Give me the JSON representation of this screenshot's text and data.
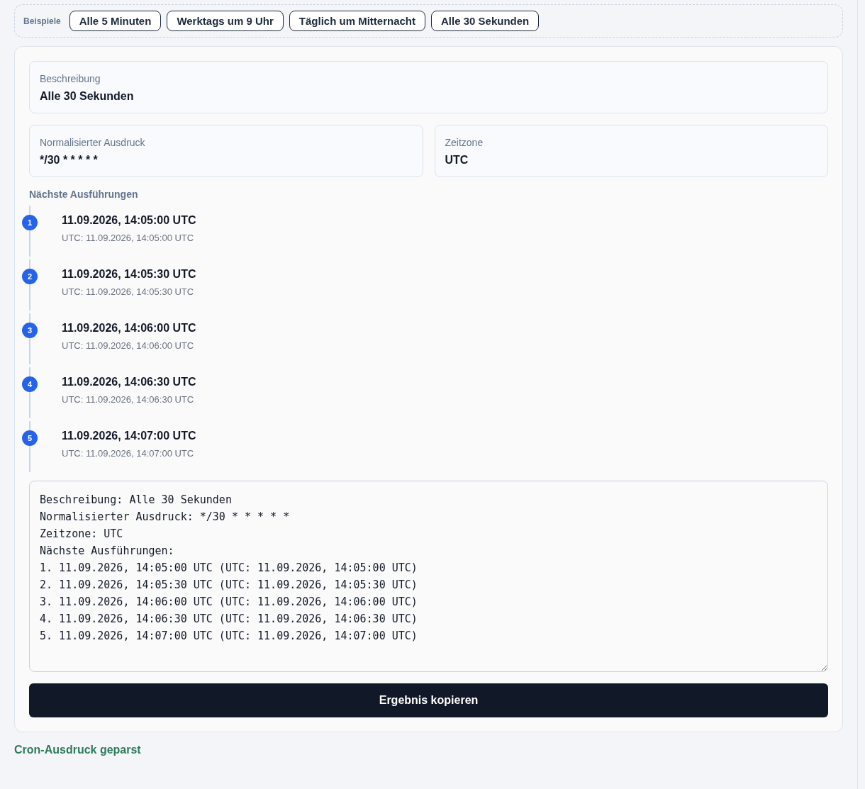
{
  "examples": {
    "label": "Beispiele",
    "buttons": [
      "Alle 5 Minuten",
      "Werktags um 9 Uhr",
      "Täglich um Mitternacht",
      "Alle 30 Sekunden"
    ]
  },
  "result": {
    "description": {
      "label": "Beschreibung",
      "value": "Alle 30 Sekunden"
    },
    "expression": {
      "label": "Normalisierter Ausdruck",
      "value": "*/30 * * * * *"
    },
    "timezone": {
      "label": "Zeitzone",
      "value": "UTC"
    },
    "runs_heading": "Nächste Ausführungen",
    "runs": [
      {
        "number": "1",
        "time": "11.09.2026, 14:05:00 UTC",
        "utc": "UTC: 11.09.2026, 14:05:00 UTC"
      },
      {
        "number": "2",
        "time": "11.09.2026, 14:05:30 UTC",
        "utc": "UTC: 11.09.2026, 14:05:30 UTC"
      },
      {
        "number": "3",
        "time": "11.09.2026, 14:06:00 UTC",
        "utc": "UTC: 11.09.2026, 14:06:00 UTC"
      },
      {
        "number": "4",
        "time": "11.09.2026, 14:06:30 UTC",
        "utc": "UTC: 11.09.2026, 14:06:30 UTC"
      },
      {
        "number": "5",
        "time": "11.09.2026, 14:07:00 UTC",
        "utc": "UTC: 11.09.2026, 14:07:00 UTC"
      }
    ],
    "output_text": "Beschreibung: Alle 30 Sekunden\nNormalisierter Ausdruck: */30 * * * * *\nZeitzone: UTC\nNächste Ausführungen:\n1. 11.09.2026, 14:05:00 UTC (UTC: 11.09.2026, 14:05:00 UTC)\n2. 11.09.2026, 14:05:30 UTC (UTC: 11.09.2026, 14:05:30 UTC)\n3. 11.09.2026, 14:06:00 UTC (UTC: 11.09.2026, 14:06:00 UTC)\n4. 11.09.2026, 14:06:30 UTC (UTC: 11.09.2026, 14:06:30 UTC)\n5. 11.09.2026, 14:07:00 UTC (UTC: 11.09.2026, 14:07:00 UTC)",
    "copy_button": "Ergebnis kopieren"
  },
  "status": "Cron-Ausdruck geparst"
}
